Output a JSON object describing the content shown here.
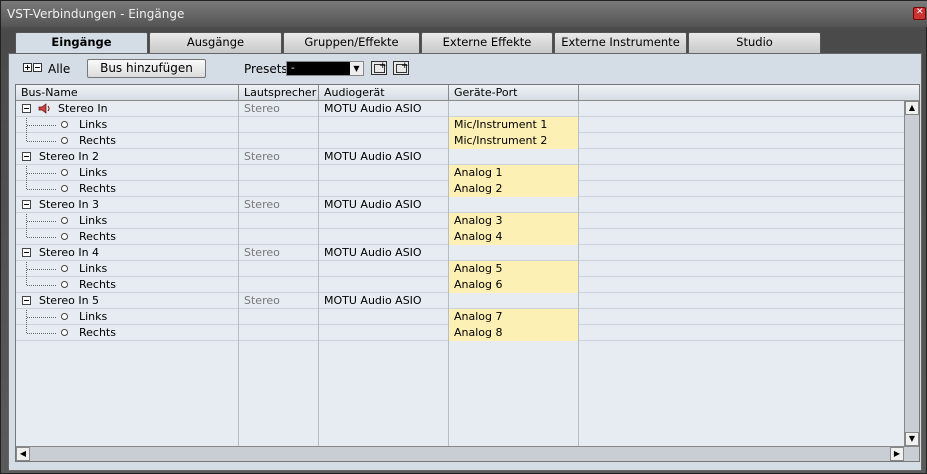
{
  "window": {
    "title": "VST-Verbindungen - Eingänge"
  },
  "tabs": [
    {
      "label": "Eingänge",
      "active": true
    },
    {
      "label": "Ausgänge",
      "active": false
    },
    {
      "label": "Gruppen/Effekte",
      "active": false
    },
    {
      "label": "Externe Effekte",
      "active": false
    },
    {
      "label": "Externe Instrumente",
      "active": false
    },
    {
      "label": "Studio",
      "active": false
    }
  ],
  "toolbar": {
    "alle_label": "Alle",
    "add_bus_label": "Bus hinzufügen",
    "presets_label": "Presets",
    "presets_value": "-"
  },
  "table": {
    "headers": [
      "Bus-Name",
      "Lautsprecher",
      "Audiogerät",
      "Geräte-Port"
    ],
    "rows": [
      {
        "kind": "bus",
        "name": "Stereo In",
        "speaker": "Stereo",
        "device": "MOTU Audio ASIO",
        "port": "",
        "icon": "speaker-icon"
      },
      {
        "kind": "channel",
        "name": "Links",
        "speaker": "",
        "device": "",
        "port": "Mic/Instrument 1"
      },
      {
        "kind": "channel",
        "name": "Rechts",
        "speaker": "",
        "device": "",
        "port": "Mic/Instrument 2"
      },
      {
        "kind": "bus",
        "name": "Stereo In 2",
        "speaker": "Stereo",
        "device": "MOTU Audio ASIO",
        "port": ""
      },
      {
        "kind": "channel",
        "name": "Links",
        "speaker": "",
        "device": "",
        "port": "Analog 1"
      },
      {
        "kind": "channel",
        "name": "Rechts",
        "speaker": "",
        "device": "",
        "port": "Analog 2"
      },
      {
        "kind": "bus",
        "name": "Stereo In 3",
        "speaker": "Stereo",
        "device": "MOTU Audio ASIO",
        "port": ""
      },
      {
        "kind": "channel",
        "name": "Links",
        "speaker": "",
        "device": "",
        "port": "Analog 3"
      },
      {
        "kind": "channel",
        "name": "Rechts",
        "speaker": "",
        "device": "",
        "port": "Analog 4"
      },
      {
        "kind": "bus",
        "name": "Stereo In 4",
        "speaker": "Stereo",
        "device": "MOTU Audio ASIO",
        "port": ""
      },
      {
        "kind": "channel",
        "name": "Links",
        "speaker": "",
        "device": "",
        "port": "Analog 5"
      },
      {
        "kind": "channel",
        "name": "Rechts",
        "speaker": "",
        "device": "",
        "port": "Analog 6"
      },
      {
        "kind": "bus",
        "name": "Stereo In 5",
        "speaker": "Stereo",
        "device": "MOTU Audio ASIO",
        "port": ""
      },
      {
        "kind": "channel",
        "name": "Links",
        "speaker": "",
        "device": "",
        "port": "Analog 7"
      },
      {
        "kind": "channel",
        "name": "Rechts",
        "speaker": "",
        "device": "",
        "port": "Analog 8"
      }
    ]
  },
  "colors": {
    "port_highlight": "#fdf0b5",
    "panel": "#d4dde6",
    "table_bg": "#e6ecf2"
  }
}
